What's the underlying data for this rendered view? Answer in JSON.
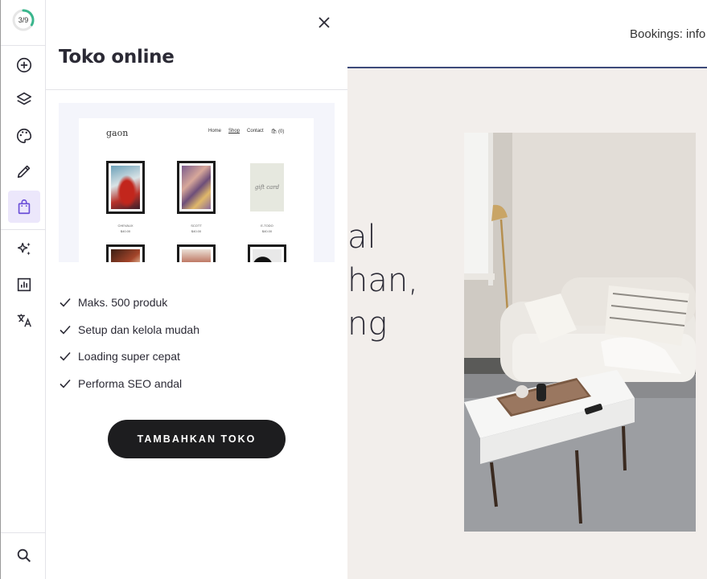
{
  "rail": {
    "progress_text": "3/9",
    "progress_fraction": 0.333,
    "buttons": [
      "add-icon",
      "layers-icon",
      "palette-icon",
      "pencil-icon",
      "shopping-bag-icon",
      "sparkles-icon",
      "analytics-icon",
      "translate-icon"
    ],
    "active_button": "shopping-bag-icon",
    "bottom_button": "search-icon"
  },
  "panel": {
    "title": "Toko online",
    "preview": {
      "logo": "gaon",
      "nav": [
        "Home",
        "Shop",
        "Contact",
        "🛍 (0)"
      ],
      "captions": [
        [
          "CHEVAUX",
          "$40.00"
        ],
        [
          "SCOTT",
          "$40.00"
        ],
        [
          "E-TODO",
          "$40.00"
        ]
      ],
      "gift_text": "gift card"
    },
    "features": [
      "Maks. 500 produk",
      "Setup dan kelola mudah",
      "Loading super cepat",
      "Performa SEO andal"
    ],
    "cta_label": "TAMBAHKAN TOKO"
  },
  "site": {
    "bookings": "Bookings: info",
    "hero_lines": [
      "al",
      "han,",
      "ng"
    ]
  },
  "colors": {
    "accent": "#ece7fb",
    "progress": "#3ab68d",
    "cta": "#1d1d1f",
    "site_bg": "#f2eeeb",
    "header_border": "#3d4a7a"
  }
}
